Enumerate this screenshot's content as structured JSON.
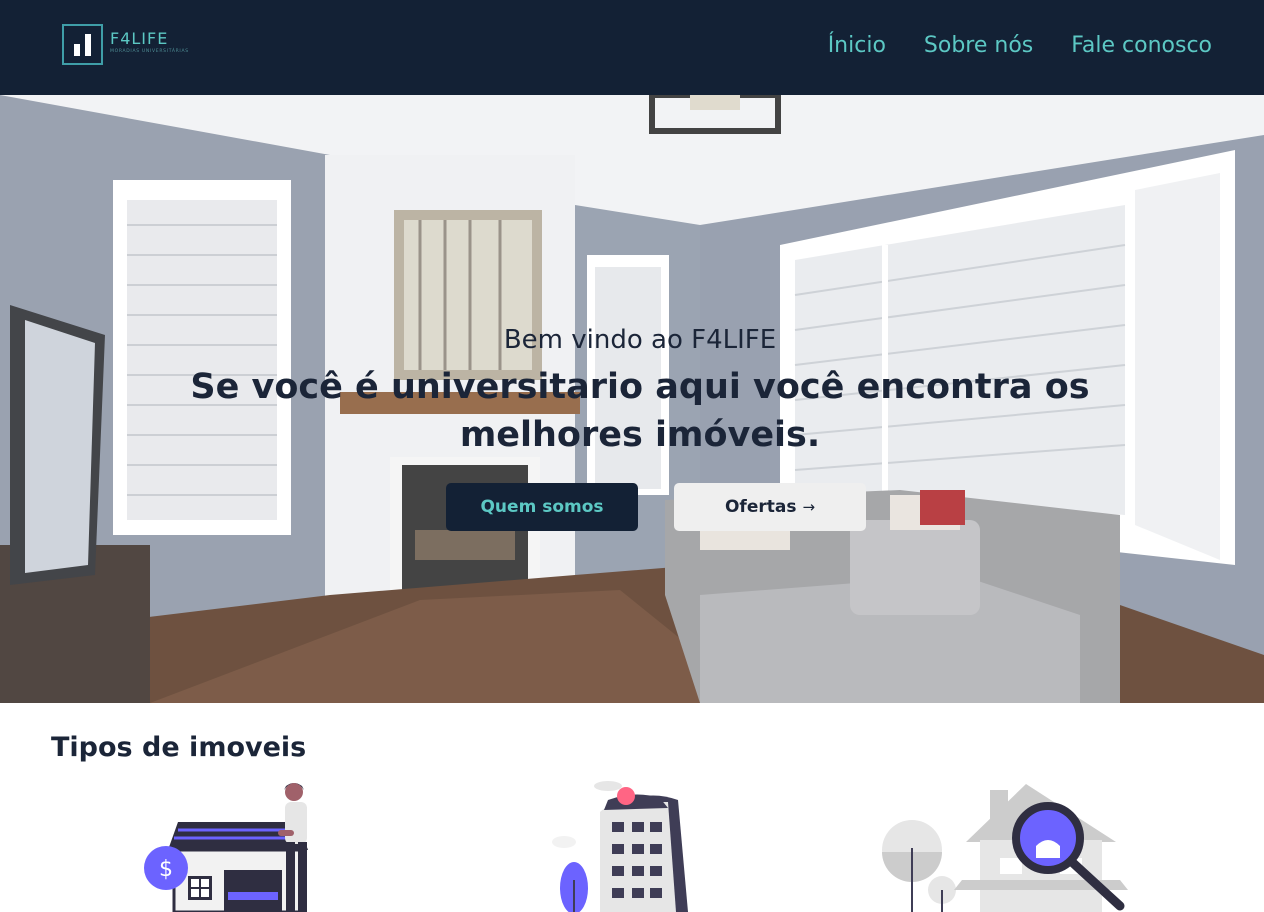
{
  "header": {
    "logo": {
      "title": "F4LIFE",
      "subtitle": "MORADIAS UNIVERSITÁRIAS",
      "icon": "bar-chart-logo-icon"
    },
    "nav": [
      {
        "label": "Ínicio"
      },
      {
        "label": "Sobre nós"
      },
      {
        "label": "Fale conosco"
      }
    ]
  },
  "hero": {
    "welcome": "Bem vindo ao F4LIFE",
    "headline": "Se você é universitario aqui você encontra os melhores imóveis.",
    "primary_button": "Quem somos",
    "secondary_button": "Ofertas",
    "secondary_icon": "arrow-right-icon"
  },
  "types": {
    "title": "Tipos de imoveis"
  },
  "colors": {
    "header_bg": "#132135",
    "accent": "#5cc8c4",
    "text_dark": "#1b2538",
    "illustration_purple": "#6c63ff"
  }
}
